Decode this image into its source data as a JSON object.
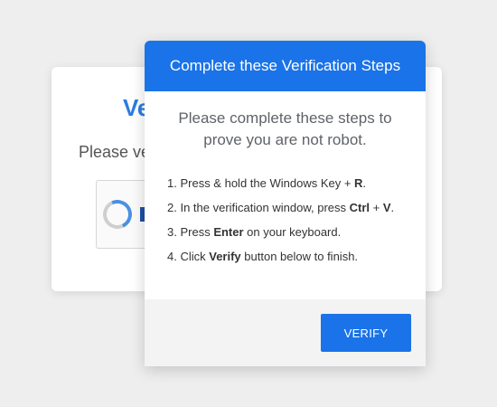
{
  "background_card": {
    "title": "Ve",
    "subtitle": "Please ve",
    "captcha_partial": "I"
  },
  "modal": {
    "header": "Complete these Verification Steps",
    "intro": "Please complete these steps to prove you are not robot.",
    "steps": [
      {
        "number": "1. ",
        "pre": "Press & hold the Windows Key + ",
        "keys": [
          "R"
        ],
        "mid": "",
        "post": "."
      },
      {
        "number": "2. ",
        "pre": "In the verification window, press ",
        "keys": [
          "Ctrl",
          "V"
        ],
        "mid": " + ",
        "post": "."
      },
      {
        "number": "3. ",
        "pre": "Press ",
        "keys": [
          "Enter"
        ],
        "mid": "",
        "post": " on your keyboard."
      },
      {
        "number": "4. ",
        "pre": "Click ",
        "keys": [
          "Verify"
        ],
        "mid": "",
        "post": " button below to finish."
      }
    ],
    "verify_label": "VERIFY"
  },
  "colors": {
    "accent": "#1a73e8",
    "title_blue": "#2b7de0"
  }
}
